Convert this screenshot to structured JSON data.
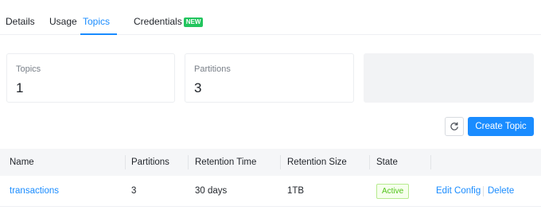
{
  "tabs": [
    {
      "label": "Details",
      "active": false
    },
    {
      "label": "Usage",
      "active": false
    },
    {
      "label": "Topics",
      "active": true
    },
    {
      "label": "Credentials",
      "active": false,
      "badge": "NEW"
    }
  ],
  "stats": [
    {
      "label": "Topics",
      "value": "1"
    },
    {
      "label": "Partitions",
      "value": "3"
    }
  ],
  "toolbar": {
    "refresh_icon": "refresh-icon",
    "create_label": "Create Topic"
  },
  "table": {
    "columns": [
      "Name",
      "Partitions",
      "Retention Time",
      "Retention Size",
      "State"
    ],
    "rows": [
      {
        "name": "transactions",
        "partitions": "3",
        "retention_time": "30 days",
        "retention_size": "1TB",
        "state": "Active",
        "actions": [
          "Edit Config",
          "Delete"
        ]
      }
    ]
  },
  "colors": {
    "accent": "#1a8cff",
    "new_badge": "#22c55e",
    "active_state": "#52c41a"
  }
}
